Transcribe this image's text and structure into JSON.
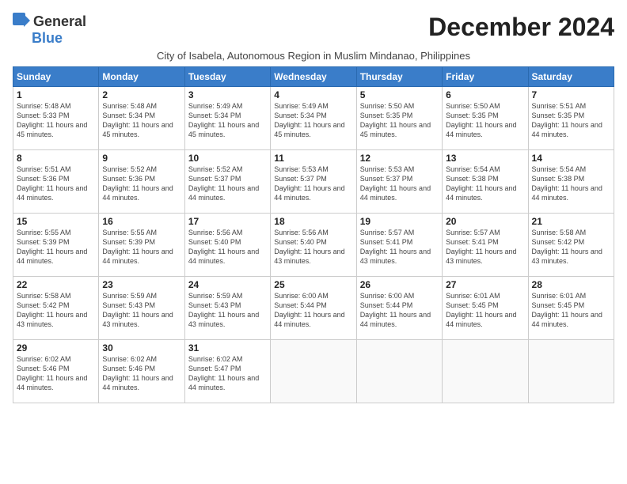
{
  "logo": {
    "general": "General",
    "blue": "Blue"
  },
  "title": "December 2024",
  "subtitle": "City of Isabela, Autonomous Region in Muslim Mindanao, Philippines",
  "days_of_week": [
    "Sunday",
    "Monday",
    "Tuesday",
    "Wednesday",
    "Thursday",
    "Friday",
    "Saturday"
  ],
  "weeks": [
    [
      {
        "day": "1",
        "sunrise": "5:48 AM",
        "sunset": "5:33 PM",
        "daylight": "11 hours and 45 minutes."
      },
      {
        "day": "2",
        "sunrise": "5:48 AM",
        "sunset": "5:34 PM",
        "daylight": "11 hours and 45 minutes."
      },
      {
        "day": "3",
        "sunrise": "5:49 AM",
        "sunset": "5:34 PM",
        "daylight": "11 hours and 45 minutes."
      },
      {
        "day": "4",
        "sunrise": "5:49 AM",
        "sunset": "5:34 PM",
        "daylight": "11 hours and 45 minutes."
      },
      {
        "day": "5",
        "sunrise": "5:50 AM",
        "sunset": "5:35 PM",
        "daylight": "11 hours and 45 minutes."
      },
      {
        "day": "6",
        "sunrise": "5:50 AM",
        "sunset": "5:35 PM",
        "daylight": "11 hours and 44 minutes."
      },
      {
        "day": "7",
        "sunrise": "5:51 AM",
        "sunset": "5:35 PM",
        "daylight": "11 hours and 44 minutes."
      }
    ],
    [
      {
        "day": "8",
        "sunrise": "5:51 AM",
        "sunset": "5:36 PM",
        "daylight": "11 hours and 44 minutes."
      },
      {
        "day": "9",
        "sunrise": "5:52 AM",
        "sunset": "5:36 PM",
        "daylight": "11 hours and 44 minutes."
      },
      {
        "day": "10",
        "sunrise": "5:52 AM",
        "sunset": "5:37 PM",
        "daylight": "11 hours and 44 minutes."
      },
      {
        "day": "11",
        "sunrise": "5:53 AM",
        "sunset": "5:37 PM",
        "daylight": "11 hours and 44 minutes."
      },
      {
        "day": "12",
        "sunrise": "5:53 AM",
        "sunset": "5:37 PM",
        "daylight": "11 hours and 44 minutes."
      },
      {
        "day": "13",
        "sunrise": "5:54 AM",
        "sunset": "5:38 PM",
        "daylight": "11 hours and 44 minutes."
      },
      {
        "day": "14",
        "sunrise": "5:54 AM",
        "sunset": "5:38 PM",
        "daylight": "11 hours and 44 minutes."
      }
    ],
    [
      {
        "day": "15",
        "sunrise": "5:55 AM",
        "sunset": "5:39 PM",
        "daylight": "11 hours and 44 minutes."
      },
      {
        "day": "16",
        "sunrise": "5:55 AM",
        "sunset": "5:39 PM",
        "daylight": "11 hours and 44 minutes."
      },
      {
        "day": "17",
        "sunrise": "5:56 AM",
        "sunset": "5:40 PM",
        "daylight": "11 hours and 44 minutes."
      },
      {
        "day": "18",
        "sunrise": "5:56 AM",
        "sunset": "5:40 PM",
        "daylight": "11 hours and 43 minutes."
      },
      {
        "day": "19",
        "sunrise": "5:57 AM",
        "sunset": "5:41 PM",
        "daylight": "11 hours and 43 minutes."
      },
      {
        "day": "20",
        "sunrise": "5:57 AM",
        "sunset": "5:41 PM",
        "daylight": "11 hours and 43 minutes."
      },
      {
        "day": "21",
        "sunrise": "5:58 AM",
        "sunset": "5:42 PM",
        "daylight": "11 hours and 43 minutes."
      }
    ],
    [
      {
        "day": "22",
        "sunrise": "5:58 AM",
        "sunset": "5:42 PM",
        "daylight": "11 hours and 43 minutes."
      },
      {
        "day": "23",
        "sunrise": "5:59 AM",
        "sunset": "5:43 PM",
        "daylight": "11 hours and 43 minutes."
      },
      {
        "day": "24",
        "sunrise": "5:59 AM",
        "sunset": "5:43 PM",
        "daylight": "11 hours and 43 minutes."
      },
      {
        "day": "25",
        "sunrise": "6:00 AM",
        "sunset": "5:44 PM",
        "daylight": "11 hours and 44 minutes."
      },
      {
        "day": "26",
        "sunrise": "6:00 AM",
        "sunset": "5:44 PM",
        "daylight": "11 hours and 44 minutes."
      },
      {
        "day": "27",
        "sunrise": "6:01 AM",
        "sunset": "5:45 PM",
        "daylight": "11 hours and 44 minutes."
      },
      {
        "day": "28",
        "sunrise": "6:01 AM",
        "sunset": "5:45 PM",
        "daylight": "11 hours and 44 minutes."
      }
    ],
    [
      {
        "day": "29",
        "sunrise": "6:02 AM",
        "sunset": "5:46 PM",
        "daylight": "11 hours and 44 minutes."
      },
      {
        "day": "30",
        "sunrise": "6:02 AM",
        "sunset": "5:46 PM",
        "daylight": "11 hours and 44 minutes."
      },
      {
        "day": "31",
        "sunrise": "6:02 AM",
        "sunset": "5:47 PM",
        "daylight": "11 hours and 44 minutes."
      },
      null,
      null,
      null,
      null
    ]
  ]
}
